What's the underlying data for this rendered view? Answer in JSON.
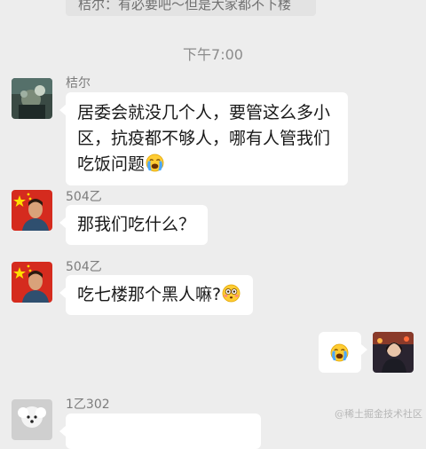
{
  "quoted_message": "桔尔：有必要吧～但是大家都不下楼",
  "timestamp": "下午7:00",
  "messages": [
    {
      "sender": "桔尔",
      "avatar": "user-photo-avatar",
      "text": "居委会就没几个人，要管这么多小区，抗疫都不够人，哪有人管我们吃饭问题",
      "emoji": "crying-face"
    },
    {
      "sender": "504乙",
      "avatar": "flag-portrait-avatar",
      "text": "那我们吃什么？"
    },
    {
      "sender": "504乙",
      "avatar": "flag-portrait-avatar",
      "text": "吃七楼那个黑人嘛?",
      "emoji": "flushed-face"
    },
    {
      "sender": "",
      "avatar": "self-avatar",
      "text": "",
      "emoji": "crying-face"
    },
    {
      "sender": "1乙302",
      "avatar": "dog-avatar",
      "text": ""
    }
  ],
  "watermark": "@稀土掘金技术社区",
  "colors": {
    "background": "#ededed",
    "bubble": "#ffffff",
    "flag_red": "#d52b1e",
    "flag_star": "#ffde00"
  }
}
